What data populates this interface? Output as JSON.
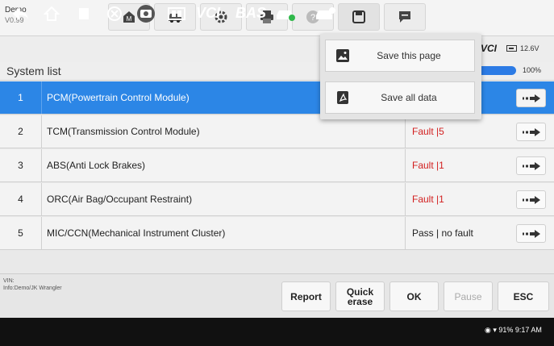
{
  "brand": {
    "name": "Demo",
    "version": "V0.99"
  },
  "toolbar": {
    "icons": [
      "home-icon",
      "vehicle-icon",
      "gear-icon",
      "print-icon",
      "help-icon",
      "save-icon",
      "chat-icon"
    ]
  },
  "save_menu": {
    "items": [
      {
        "label": "Save this page",
        "icon": "image-icon"
      },
      {
        "label": "Save all data",
        "icon": "pdf-icon"
      }
    ]
  },
  "status": {
    "vci_label": "VCI",
    "voltage": "12.6V",
    "progress_text": "100%",
    "progress": 1.0
  },
  "system_list": {
    "title": "System list",
    "rows": [
      {
        "num": "1",
        "name": "PCM(Powertrain Control Module)",
        "status": "",
        "fault": false
      },
      {
        "num": "2",
        "name": "TCM(Transmission Control Module)",
        "status": "Fault |5",
        "fault": true
      },
      {
        "num": "3",
        "name": "ABS(Anti Lock Brakes)",
        "status": "Fault |1",
        "fault": true
      },
      {
        "num": "4",
        "name": "ORC(Air Bag/Occupant Restraint)",
        "status": "Fault |1",
        "fault": true
      },
      {
        "num": "5",
        "name": "MIC/CCN(Mechanical Instrument Cluster)",
        "status": "Pass | no fault",
        "fault": false
      }
    ]
  },
  "info": {
    "vin": "VIN:",
    "info": "Info:Demo/JK Wrangler"
  },
  "buttons": {
    "report": "Report",
    "quick_erase": "Quick erase",
    "ok": "OK",
    "pause": "Pause",
    "esc": "ESC"
  },
  "android": {
    "vci": "VCI",
    "bas": "BAS",
    "system_status": "91% 9:17 AM"
  },
  "colors": {
    "accent": "#2c86e6",
    "fault": "#d21f1f"
  }
}
